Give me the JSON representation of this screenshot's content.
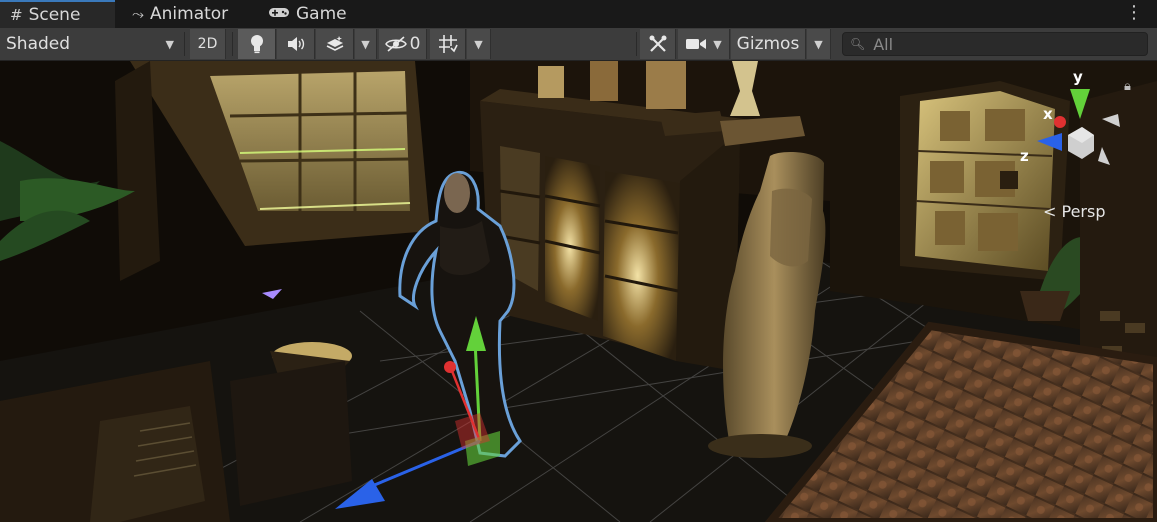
{
  "tabs": [
    {
      "label": "Scene",
      "icon": "grid-hash-icon",
      "active": true
    },
    {
      "label": "Animator",
      "icon": "animator-icon",
      "active": false
    },
    {
      "label": "Game",
      "icon": "gamepad-icon",
      "active": false
    }
  ],
  "toolbar": {
    "draw_mode": "Shaded",
    "mode_2d": "2D",
    "hidden_count": "0",
    "gizmos_label": "Gizmos",
    "search_placeholder": "All"
  },
  "view": {
    "projection_label": "Persp",
    "axis_labels": {
      "x": "x",
      "y": "y",
      "z": "z"
    }
  },
  "colors": {
    "accent_tab": "#3a79bb",
    "axis_x": "#e03131",
    "axis_y": "#63d13a",
    "axis_z": "#2a62e8",
    "selection_outline": "#6aa0d8"
  }
}
